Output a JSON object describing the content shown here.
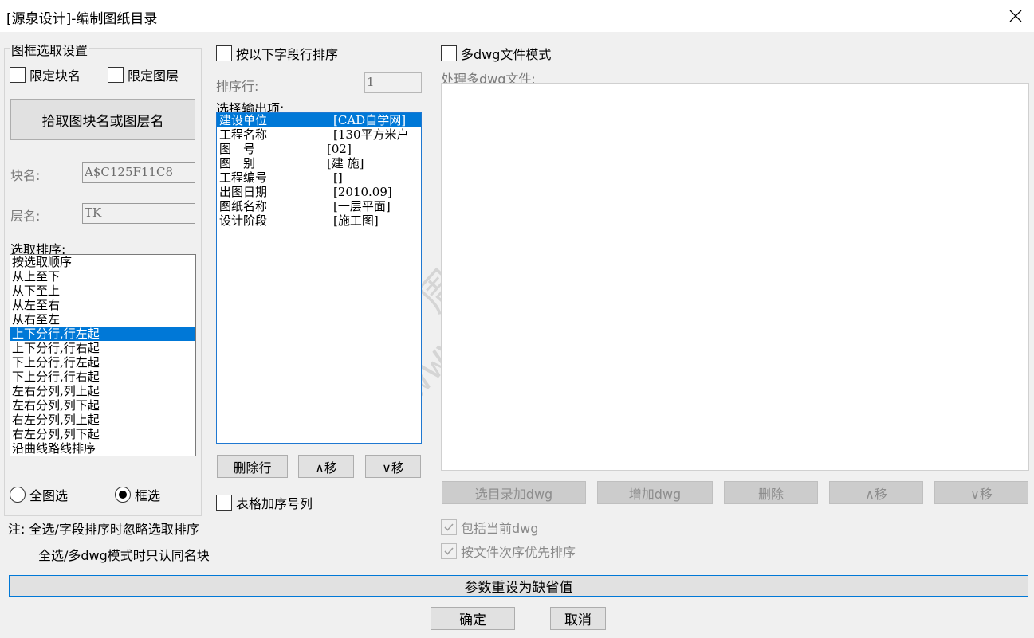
{
  "window": {
    "title": "[源泉设计]-编制图纸目录",
    "close_icon": "close-icon"
  },
  "left": {
    "group_title": "图框选取设置",
    "limit_block_name": {
      "label": "限定块名",
      "checked": false
    },
    "limit_layer": {
      "label": "限定图层",
      "checked": false
    },
    "pick_button": "拾取图块名或图层名",
    "block_name_label": "块名:",
    "block_name_value": "A$C125F11C8",
    "layer_name_label": "层名:",
    "layer_name_value": "TK",
    "sort_label": "选取排序:",
    "sort_options": [
      "按选取顺序",
      "从上至下",
      "从下至上",
      "从左至右",
      "从右至左",
      "上下分行,行左起",
      "上下分行,行右起",
      "下上分行,行左起",
      "下上分行,行右起",
      "左右分列,列上起",
      "左右分列,列下起",
      "右左分列,列上起",
      "右左分列,列下起",
      "沿曲线路线排序"
    ],
    "sort_selected_index": 5,
    "radio_all": {
      "label": "全图选",
      "checked": false
    },
    "radio_box": {
      "label": "框选",
      "checked": true
    }
  },
  "middle": {
    "sort_by_field": {
      "label": "按以下字段行排序",
      "checked": false
    },
    "sort_row_label": "排序行:",
    "sort_row_value": "1",
    "output_label": "选择输出项:",
    "output_items": [
      {
        "name": "建设单位",
        "value": "[CAD自学网]"
      },
      {
        "name": "工程名称",
        "value": "[130平方米户"
      },
      {
        "name": "图　号",
        "value": "[02]"
      },
      {
        "name": "图　别",
        "value": "[建 施]"
      },
      {
        "name": "工程编号",
        "value": "[]"
      },
      {
        "name": "出图日期",
        "value": "[2010.09]"
      },
      {
        "name": "图纸名称",
        "value": "[一层平面]"
      },
      {
        "name": "设计阶段",
        "value": "[施工图]"
      }
    ],
    "output_selected_index": 0,
    "delete_row_button": "删除行",
    "move_up_button": "∧移",
    "move_down_button": "∨移",
    "add_serial_column": {
      "label": "表格加序号列",
      "checked": false
    }
  },
  "right": {
    "multi_dwg_mode": {
      "label": "多dwg文件模式",
      "checked": false
    },
    "process_label": "处理多dwg文件:",
    "add_dir_button": "选目录加dwg",
    "add_dwg_button": "增加dwg",
    "delete_button": "删除",
    "move_up_button": "∧移",
    "move_down_button": "∨移",
    "include_current": {
      "label": "包括当前dwg",
      "checked": true
    },
    "sort_file_order": {
      "label": "按文件次序优先排序",
      "checked": true
    }
  },
  "notes": {
    "line1": "注: 全选/字段排序时忽略选取排序",
    "line2": "全选/多dwg模式时只认同名块"
  },
  "bottom": {
    "reset_button": "参数重设为缺省值",
    "ok_button": "确定",
    "cancel_button": "取消"
  },
  "watermark": {
    "line1": "周站长CAD",
    "line2": "www.zzzcad.com"
  },
  "colors": {
    "selection": "#0078d7",
    "background": "#f0f0f0"
  }
}
